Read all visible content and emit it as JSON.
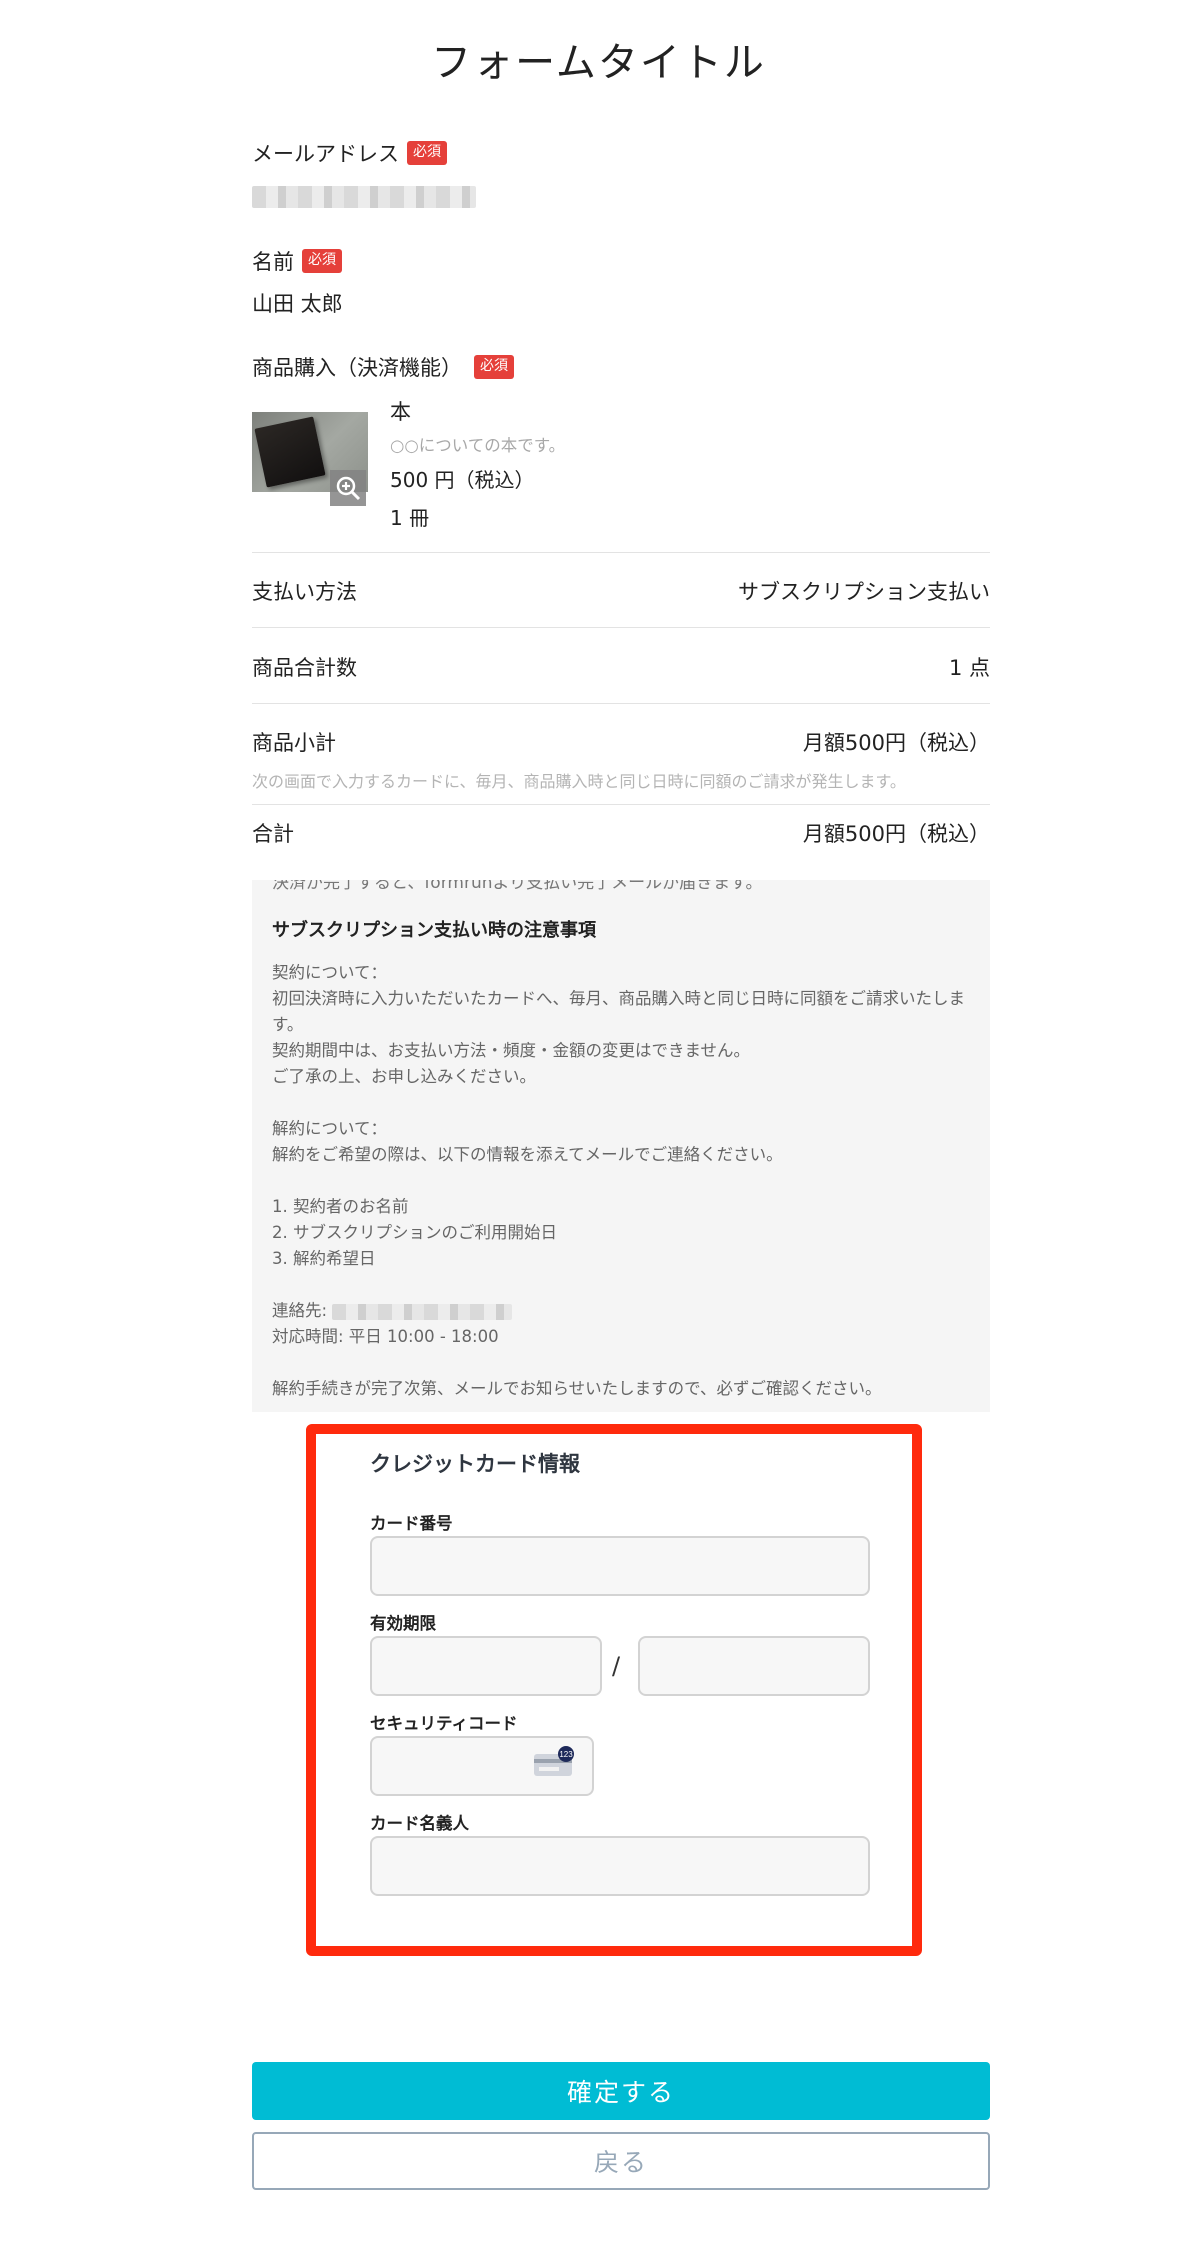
{
  "form_title": "フォームタイトル",
  "required_badge": "必須",
  "email": {
    "label": "メールアドレス"
  },
  "name": {
    "label": "名前",
    "value": "山田 太郎"
  },
  "purchase": {
    "label": "商品購入（決済機能）",
    "product": {
      "name": "本",
      "description": "○○についての本です。",
      "price": "500 円（税込）",
      "quantity": "1 冊"
    }
  },
  "summary": {
    "payment_method_label": "支払い方法",
    "payment_method_value": "サブスクリプション支払い",
    "total_count_label": "商品合計数",
    "total_count_value": "1 点",
    "subtotal_label": "商品小計",
    "subtotal_value": "月額500円（税込）",
    "subtotal_note": "次の画面で入力するカードに、毎月、商品購入時と同じ日時に同額のご請求が発生します。",
    "total_label": "合計",
    "total_value": "月額500円（税込）"
  },
  "notice": {
    "cut_line": "決済が完了すると、formrunより支払い完了メールが届きます。",
    "heading": "サブスクリプション支払い時の注意事項",
    "contract_title": "契約について：",
    "contract_line1": "初回決済時に入力いただいたカードへ、毎月、商品購入時と同じ日時に同額をご請求いたしま",
    "contract_line1b": "す。",
    "contract_line2": "契約期間中は、お支払い方法・頻度・金額の変更はできません。",
    "contract_line3": "ご了承の上、お申し込みください。",
    "cancel_title": "解約について：",
    "cancel_line1": "解約をご希望の際は、以下の情報を添えてメールでご連絡ください。",
    "list": [
      "1. 契約者のお名前",
      "2. サブスクリプションのご利用開始日",
      "3. 解約希望日"
    ],
    "contact_label": "連絡先:",
    "hours": "対応時間: 平日 10:00 - 18:00",
    "closing": "解約手続きが完了次第、メールでお知らせいたしますので、必ずご確認ください。"
  },
  "card": {
    "title": "クレジットカード情報",
    "number_label": "カード番号",
    "expiry_label": "有効期限",
    "expiry_separator": "/",
    "cvc_label": "セキュリティコード",
    "cvc_badge": "123",
    "holder_label": "カード名義人"
  },
  "buttons": {
    "confirm": "確定する",
    "back": "戻る"
  },
  "colors": {
    "accent": "#00bcd4",
    "required": "#e5403a",
    "highlight_frame": "#ff2a0d"
  }
}
